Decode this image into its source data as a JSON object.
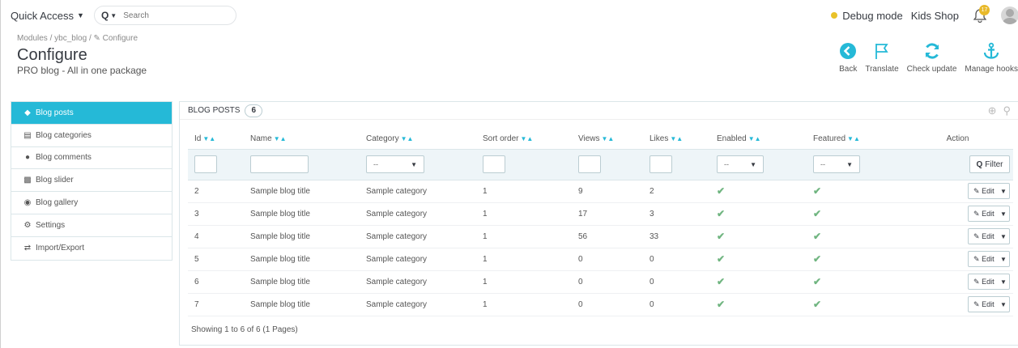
{
  "header": {
    "quick_access": "Quick Access",
    "search_placeholder": "Search",
    "debug_mode": "Debug mode",
    "shop_name": "Kids Shop",
    "notification_count": "17"
  },
  "breadcrumb": "Modules / ybc_blog / ✎ Configure",
  "page": {
    "title": "Configure",
    "subtitle": "PRO blog - All in one package"
  },
  "toolbar": {
    "back": "Back",
    "translate": "Translate",
    "check_update": "Check update",
    "manage_hooks": "Manage hooks"
  },
  "sidebar": {
    "items": [
      {
        "label": "Blog posts",
        "icon": "tag-icon"
      },
      {
        "label": "Blog categories",
        "icon": "book-icon"
      },
      {
        "label": "Blog comments",
        "icon": "comments-icon"
      },
      {
        "label": "Blog slider",
        "icon": "sitemap-icon"
      },
      {
        "label": "Blog gallery",
        "icon": "gallery-icon"
      },
      {
        "label": "Settings",
        "icon": "gear-icon"
      },
      {
        "label": "Import/Export",
        "icon": "exchange-icon"
      }
    ]
  },
  "panel": {
    "title": "BLOG POSTS",
    "count": "6",
    "columns": [
      "Id",
      "Name",
      "Category",
      "Sort order",
      "Views",
      "Likes",
      "Enabled",
      "Featured",
      "Action"
    ],
    "select_placeholder": "--",
    "filter_label": "Filter",
    "edit_label": "Edit",
    "rows": [
      {
        "id": "2",
        "name": "Sample blog title",
        "category": "Sample category",
        "sort": "1",
        "views": "9",
        "likes": "2"
      },
      {
        "id": "3",
        "name": "Sample blog title",
        "category": "Sample category",
        "sort": "1",
        "views": "17",
        "likes": "3"
      },
      {
        "id": "4",
        "name": "Sample blog title",
        "category": "Sample category",
        "sort": "1",
        "views": "56",
        "likes": "33"
      },
      {
        "id": "5",
        "name": "Sample blog title",
        "category": "Sample category",
        "sort": "1",
        "views": "0",
        "likes": "0"
      },
      {
        "id": "6",
        "name": "Sample blog title",
        "category": "Sample category",
        "sort": "1",
        "views": "0",
        "likes": "0"
      },
      {
        "id": "7",
        "name": "Sample blog title",
        "category": "Sample category",
        "sort": "1",
        "views": "0",
        "likes": "0"
      }
    ],
    "showing": "Showing 1 to 6 of 6 (1 Pages)"
  },
  "colors": {
    "accent": "#25b9d7",
    "check": "#70b580",
    "debug": "#e9c229"
  }
}
